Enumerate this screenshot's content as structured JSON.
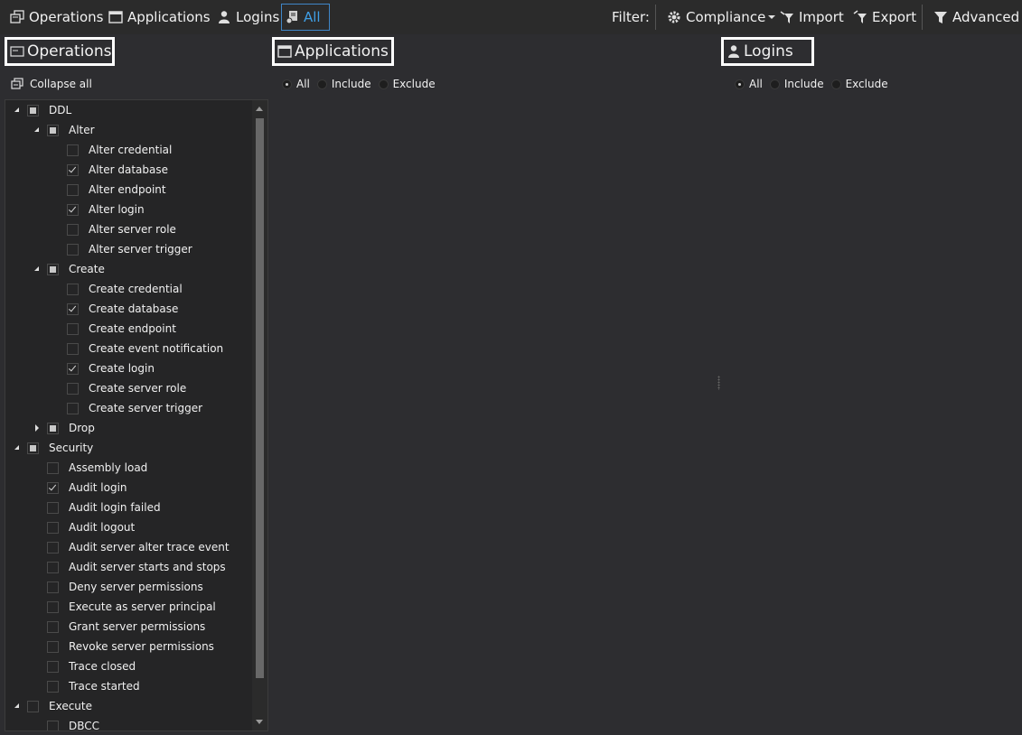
{
  "toolbar": {
    "operations": "Operations",
    "applications": "Applications",
    "logins": "Logins",
    "all": "All",
    "filter_label": "Filter:",
    "compliance": "Compliance",
    "import": "Import",
    "export": "Export",
    "advanced": "Advanced"
  },
  "sections": {
    "operations": "Operations",
    "applications": "Applications",
    "logins": "Logins"
  },
  "collapse_all": "Collapse all",
  "applications_filter": {
    "options": [
      "All",
      "Include",
      "Exclude"
    ],
    "selected": "All"
  },
  "logins_filter": {
    "options": [
      "All",
      "Include",
      "Exclude"
    ],
    "selected": "All"
  },
  "tree": [
    {
      "label": "DDL",
      "level": 0,
      "expander": "open",
      "state": "partial"
    },
    {
      "label": "Alter",
      "level": 1,
      "expander": "open",
      "state": "partial"
    },
    {
      "label": "Alter credential",
      "level": 2,
      "state": "unchecked"
    },
    {
      "label": "Alter database",
      "level": 2,
      "state": "checked"
    },
    {
      "label": "Alter endpoint",
      "level": 2,
      "state": "unchecked"
    },
    {
      "label": "Alter login",
      "level": 2,
      "state": "checked"
    },
    {
      "label": "Alter server role",
      "level": 2,
      "state": "unchecked"
    },
    {
      "label": "Alter server trigger",
      "level": 2,
      "state": "unchecked"
    },
    {
      "label": "Create",
      "level": 1,
      "expander": "open",
      "state": "partial"
    },
    {
      "label": "Create credential",
      "level": 2,
      "state": "unchecked"
    },
    {
      "label": "Create database",
      "level": 2,
      "state": "checked"
    },
    {
      "label": "Create endpoint",
      "level": 2,
      "state": "unchecked"
    },
    {
      "label": "Create event notification",
      "level": 2,
      "state": "unchecked"
    },
    {
      "label": "Create login",
      "level": 2,
      "state": "checked"
    },
    {
      "label": "Create server role",
      "level": 2,
      "state": "unchecked"
    },
    {
      "label": "Create server trigger",
      "level": 2,
      "state": "unchecked"
    },
    {
      "label": "Drop",
      "level": 1,
      "expander": "closed",
      "state": "partial"
    },
    {
      "label": "Security",
      "level": 0,
      "expander": "open",
      "state": "partial"
    },
    {
      "label": "Assembly load",
      "level": 1,
      "state": "unchecked"
    },
    {
      "label": "Audit login",
      "level": 1,
      "state": "checked"
    },
    {
      "label": "Audit login failed",
      "level": 1,
      "state": "unchecked"
    },
    {
      "label": "Audit logout",
      "level": 1,
      "state": "unchecked"
    },
    {
      "label": "Audit server alter trace event",
      "level": 1,
      "state": "unchecked"
    },
    {
      "label": "Audit server starts and stops",
      "level": 1,
      "state": "unchecked"
    },
    {
      "label": "Deny server permissions",
      "level": 1,
      "state": "unchecked"
    },
    {
      "label": "Execute as server principal",
      "level": 1,
      "state": "unchecked"
    },
    {
      "label": "Grant server permissions",
      "level": 1,
      "state": "unchecked"
    },
    {
      "label": "Revoke server permissions",
      "level": 1,
      "state": "unchecked"
    },
    {
      "label": "Trace closed",
      "level": 1,
      "state": "unchecked"
    },
    {
      "label": "Trace started",
      "level": 1,
      "state": "unchecked"
    },
    {
      "label": "Execute",
      "level": 0,
      "expander": "open",
      "state": "unchecked"
    },
    {
      "label": "DBCC",
      "level": 1,
      "state": "unchecked"
    }
  ]
}
